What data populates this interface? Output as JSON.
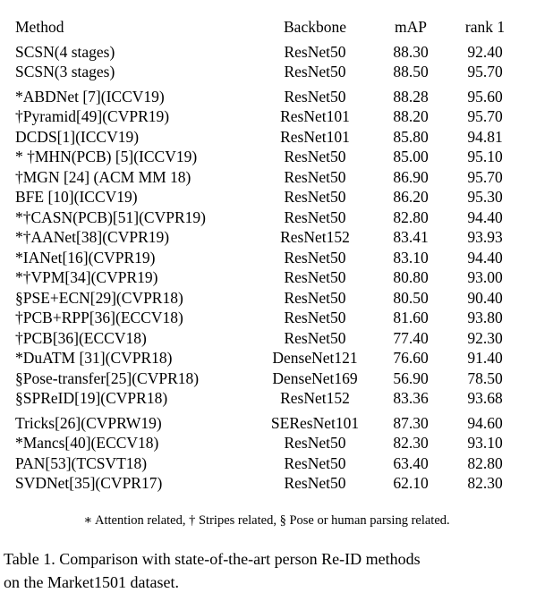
{
  "table": {
    "columns": [
      "Method",
      "Backbone",
      "mAP",
      "rank 1"
    ],
    "sections": [
      {
        "id": "ours",
        "rows": [
          {
            "method": "SCSN(4 stages)",
            "method_bold": true,
            "backbone": "ResNet50",
            "map": "88.30",
            "map_bold": false,
            "rank1": "92.40",
            "rank1_bold": false
          },
          {
            "method": "SCSN(3 stages)",
            "method_bold": true,
            "backbone": "ResNet50",
            "map": "88.50",
            "map_bold": true,
            "rank1": "95.70",
            "rank1_bold": true
          }
        ]
      },
      {
        "id": "sota",
        "rows": [
          {
            "method": "*ABDNet [7](ICCV19)",
            "method_bold": false,
            "backbone": "ResNet50",
            "map": "88.28",
            "map_bold": false,
            "rank1": "95.60",
            "rank1_bold": false
          },
          {
            "method": "†Pyramid[49](CVPR19)",
            "method_bold": false,
            "backbone": "ResNet101",
            "map": "88.20",
            "map_bold": false,
            "rank1": "95.70",
            "rank1_bold": true
          },
          {
            "method": "DCDS[1](ICCV19)",
            "method_bold": false,
            "backbone": "ResNet101",
            "map": "85.80",
            "map_bold": false,
            "rank1": "94.81",
            "rank1_bold": false
          },
          {
            "method": "* †MHN(PCB) [5](ICCV19)",
            "method_bold": false,
            "backbone": "ResNet50",
            "map": "85.00",
            "map_bold": false,
            "rank1": "95.10",
            "rank1_bold": false
          },
          {
            "method": "†MGN [24] (ACM MM 18)",
            "method_bold": false,
            "backbone": "ResNet50",
            "map": "86.90",
            "map_bold": false,
            "rank1": "95.70",
            "rank1_bold": false
          },
          {
            "method": "BFE [10](ICCV19)",
            "method_bold": false,
            "backbone": "ResNet50",
            "map": "86.20",
            "map_bold": false,
            "rank1": "95.30",
            "rank1_bold": false
          },
          {
            "method": "*†CASN(PCB)[51](CVPR19)",
            "method_bold": false,
            "backbone": "ResNet50",
            "map": "82.80",
            "map_bold": false,
            "rank1": "94.40",
            "rank1_bold": false
          },
          {
            "method": "*†AANet[38](CVPR19)",
            "method_bold": false,
            "backbone": "ResNet152",
            "map": "83.41",
            "map_bold": false,
            "rank1": "93.93",
            "rank1_bold": false
          },
          {
            "method": "*IANet[16](CVPR19)",
            "method_bold": false,
            "backbone": "ResNet50",
            "map": "83.10",
            "map_bold": false,
            "rank1": "94.40",
            "rank1_bold": false
          },
          {
            "method": "*†VPM[34](CVPR19)",
            "method_bold": false,
            "backbone": "ResNet50",
            "map": "80.80",
            "map_bold": false,
            "rank1": "93.00",
            "rank1_bold": false
          },
          {
            "method": "§PSE+ECN[29](CVPR18)",
            "method_bold": false,
            "backbone": "ResNet50",
            "map": "80.50",
            "map_bold": false,
            "rank1": "90.40",
            "rank1_bold": false
          },
          {
            "method": "†PCB+RPP[36](ECCV18)",
            "method_bold": false,
            "backbone": "ResNet50",
            "map": "81.60",
            "map_bold": false,
            "rank1": "93.80",
            "rank1_bold": false
          },
          {
            "method": "†PCB[36](ECCV18)",
            "method_bold": false,
            "backbone": "ResNet50",
            "map": "77.40",
            "map_bold": false,
            "rank1": "92.30",
            "rank1_bold": false
          },
          {
            "method": "*DuATM [31](CVPR18)",
            "method_bold": false,
            "backbone": "DenseNet121",
            "map": "76.60",
            "map_bold": false,
            "rank1": "91.40",
            "rank1_bold": false
          },
          {
            "method": "§Pose-transfer[25](CVPR18)",
            "method_bold": false,
            "backbone": "DenseNet169",
            "map": "56.90",
            "map_bold": false,
            "rank1": "78.50",
            "rank1_bold": false
          },
          {
            "method": "§SPReID[19](CVPR18)",
            "method_bold": false,
            "backbone": "ResNet152",
            "map": "83.36",
            "map_bold": false,
            "rank1": "93.68",
            "rank1_bold": false
          }
        ]
      },
      {
        "id": "others",
        "rows": [
          {
            "method": "Tricks[26](CVPRW19)",
            "method_bold": false,
            "backbone": "SEResNet101",
            "map": "87.30",
            "map_bold": false,
            "rank1": "94.60",
            "rank1_bold": false
          },
          {
            "method": "*Mancs[40](ECCV18)",
            "method_bold": false,
            "backbone": "ResNet50",
            "map": "82.30",
            "map_bold": false,
            "rank1": "93.10",
            "rank1_bold": false
          },
          {
            "method": "PAN[53](TCSVT18)",
            "method_bold": false,
            "backbone": "ResNet50",
            "map": "63.40",
            "map_bold": false,
            "rank1": "82.80",
            "rank1_bold": false
          },
          {
            "method": "SVDNet[35](CVPR17)",
            "method_bold": false,
            "backbone": "ResNet50",
            "map": "62.10",
            "map_bold": false,
            "rank1": "82.30",
            "rank1_bold": false
          }
        ]
      }
    ]
  },
  "footnote": "∗ Attention related, † Stripes related, § Pose or human parsing related.",
  "caption": {
    "line1": "Table 1. Comparison with state-of-the-art person Re-ID methods",
    "line2": "on the Market1501 dataset."
  }
}
